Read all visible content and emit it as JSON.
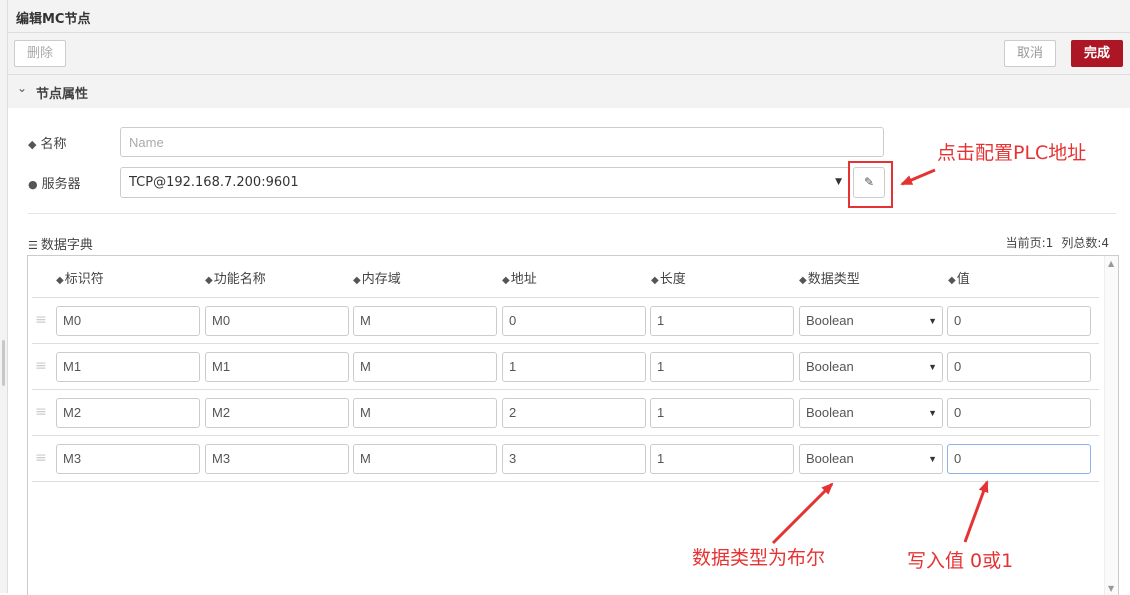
{
  "window": {
    "title": "编辑MC节点"
  },
  "toolbar": {
    "delete_label": "删除",
    "cancel_label": "取消",
    "done_label": "完成"
  },
  "section": {
    "title": "节点属性"
  },
  "form": {
    "name_label": "名称",
    "name_placeholder": "Name",
    "name_value": "",
    "server_label": "服务器",
    "server_value": "TCP@192.168.7.200:9601"
  },
  "dictionary": {
    "label": "数据字典",
    "current_page": "当前页:1",
    "total_columns": "列总数:4",
    "columns": [
      "标识符",
      "功能名称",
      "内存域",
      "地址",
      "长度",
      "数据类型",
      "值"
    ],
    "rows": [
      {
        "id": "M0",
        "name": "M0",
        "area": "M",
        "address": "0",
        "length": "1",
        "type": "Boolean",
        "value": "0"
      },
      {
        "id": "M1",
        "name": "M1",
        "area": "M",
        "address": "1",
        "length": "1",
        "type": "Boolean",
        "value": "0"
      },
      {
        "id": "M2",
        "name": "M2",
        "area": "M",
        "address": "2",
        "length": "1",
        "type": "Boolean",
        "value": "0"
      },
      {
        "id": "M3",
        "name": "M3",
        "area": "M",
        "address": "3",
        "length": "1",
        "type": "Boolean",
        "value": "0"
      }
    ]
  },
  "annotations": {
    "plc": "点击配置PLC地址",
    "type": "数据类型为布尔",
    "value": "写入值 0或1",
    "color": "#e53333"
  },
  "colors": {
    "accent": "#ad1625",
    "annotation": "#e53333",
    "panel": "#f3f3f3"
  },
  "icons": [
    "tag-icon",
    "globe-icon",
    "pencil-icon",
    "list-icon",
    "drag-handle-icon",
    "chevron-down-icon",
    "dropdown-arrow-icon"
  ]
}
